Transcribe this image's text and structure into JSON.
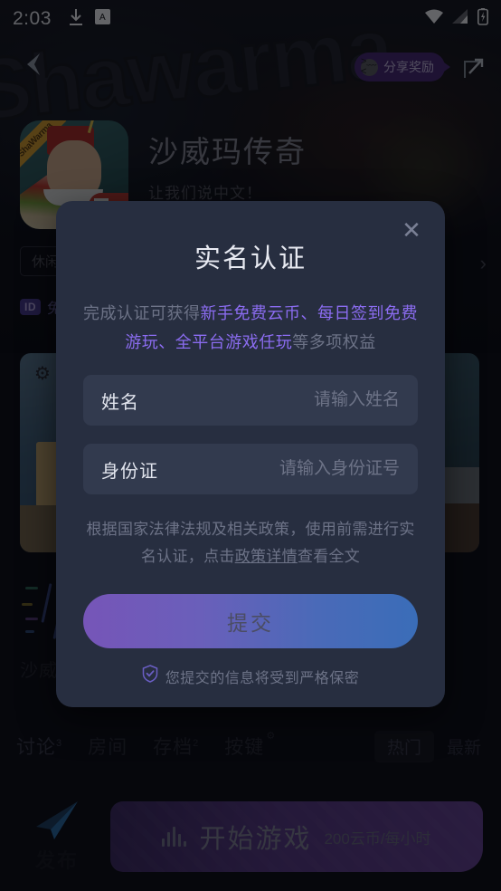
{
  "statusbar": {
    "time": "2:03",
    "icons": [
      "download-icon",
      "app-badge-icon",
      "wifi-icon",
      "signal-icon",
      "battery-icon"
    ]
  },
  "background": {
    "hero_word": "Shawarma",
    "back_icon": "back-arrow-icon",
    "share_pill_label": "分享奖励",
    "share_pill_emoji": "angry-face-icon",
    "share_icon": "share-arrow-icon",
    "game": {
      "icon_ribbon": "ShaWarma",
      "title": "沙威玛传奇",
      "subtitle": "让我们说中文！"
    },
    "tags": [
      "休闲"
    ],
    "chevron_right": "chevron-right-icon",
    "id_badge": "ID",
    "id_text": "免",
    "thumb_label": "沙威",
    "tabs": [
      {
        "label": "讨论",
        "sup": "3"
      },
      {
        "label": "房间",
        "sup": ""
      },
      {
        "label": "存档",
        "sup": "2"
      },
      {
        "label": "按键",
        "sup": ""
      }
    ],
    "tab_gear_icon": "gear-icon",
    "filter_hot": "热门",
    "filter_new": "最新",
    "publish_label": "发布",
    "publish_icon": "paper-plane-icon",
    "start_button": {
      "label": "开始游戏",
      "price": "200云币/每小时",
      "wave_icon": "audio-wave-icon"
    }
  },
  "modal": {
    "title": "实名认证",
    "close_icon": "close-icon",
    "desc": {
      "part1": "完成认证可获得",
      "hl1": "新手免费云币、每日签到免费游玩、全平台游戏任玩",
      "part2": "等多项权益"
    },
    "fields": [
      {
        "label": "姓名",
        "placeholder": "请输入姓名",
        "value": ""
      },
      {
        "label": "身份证",
        "placeholder": "请输入身份证号",
        "value": ""
      }
    ],
    "policy": {
      "before": "根据国家法律法规及相关政策，使用前需进行实名认证，点击",
      "link": "政策详情",
      "after": "查看全文"
    },
    "submit_label": "提交",
    "secure_icon": "shield-check-icon",
    "secure_text": "您提交的信息将受到严格保密"
  },
  "colors": {
    "modal_bg": "#272e40",
    "field_bg": "#323a4e",
    "accent_purple": "#8b6cf0",
    "submit_gradient_start": "#7655b8",
    "submit_gradient_end": "#3a6db8",
    "start_button_purple": "#6a4397"
  }
}
